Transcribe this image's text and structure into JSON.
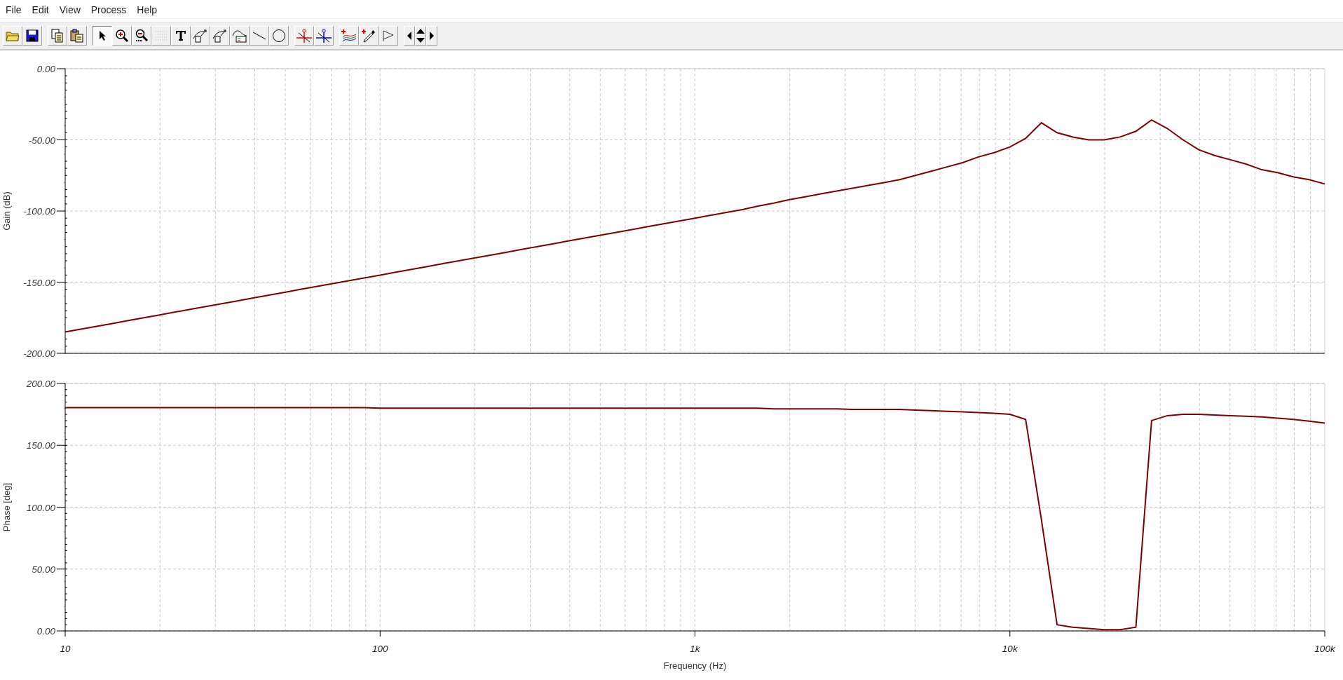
{
  "menu": [
    "File",
    "Edit",
    "View",
    "Process",
    "Help"
  ],
  "toolbar": [
    {
      "kind": "open",
      "selected": false
    },
    {
      "kind": "save",
      "selected": false
    },
    {
      "kind": "separator"
    },
    {
      "kind": "copy",
      "selected": false
    },
    {
      "kind": "paste",
      "selected": false
    },
    {
      "kind": "separator"
    },
    {
      "kind": "pointer",
      "selected": true
    },
    {
      "kind": "zoom-in",
      "selected": false
    },
    {
      "kind": "zoom-out",
      "selected": false
    },
    {
      "kind": "grid",
      "selected": false
    },
    {
      "kind": "text",
      "selected": false
    },
    {
      "kind": "label",
      "selected": false
    },
    {
      "kind": "label-query",
      "selected": false
    },
    {
      "kind": "legend",
      "selected": false
    },
    {
      "kind": "line",
      "selected": false
    },
    {
      "kind": "circle",
      "selected": false
    },
    {
      "kind": "separator"
    },
    {
      "kind": "cursor-a",
      "selected": false
    },
    {
      "kind": "cursor-b",
      "selected": false
    },
    {
      "kind": "separator"
    },
    {
      "kind": "add-curve",
      "selected": false
    },
    {
      "kind": "probe",
      "selected": false
    },
    {
      "kind": "marker",
      "selected": false
    },
    {
      "kind": "separator"
    },
    {
      "kind": "nav-left",
      "selected": false
    },
    {
      "kind": "nav-updown",
      "selected": false
    },
    {
      "kind": "nav-right",
      "selected": false
    }
  ],
  "plots": [
    {
      "chart_data": {
        "type": "line",
        "ylabel": "Gain (dB)",
        "grid": true,
        "ylim": [
          -200,
          0
        ],
        "yticks": [
          {
            "value": 0,
            "label": "0.00"
          },
          {
            "value": -50,
            "label": "-50.00"
          },
          {
            "value": -100,
            "label": "-100.00"
          },
          {
            "value": -150,
            "label": "-150.00"
          },
          {
            "value": -200,
            "label": "-200.00"
          }
        ],
        "series": [
          {
            "color": "#800000",
            "values": [
              -185,
              -183,
              -181,
              -179,
              -177,
              -175,
              -173,
              -171,
              -169,
              -167,
              -165,
              -163,
              -161,
              -159,
              -157,
              -155,
              -153,
              -151,
              -149,
              -147,
              -145,
              -143,
              -141,
              -139,
              -137,
              -135,
              -133,
              -131,
              -129,
              -127,
              -125,
              -123,
              -121,
              -119,
              -117,
              -115,
              -113,
              -111,
              -109,
              -107,
              -105,
              -103,
              -101,
              -99,
              -96.5,
              -94.5,
              -92,
              -90,
              -88,
              -86,
              -84,
              -82,
              -80,
              -78,
              -75,
              -72,
              -69,
              -66,
              -62,
              -59,
              -55,
              -49,
              -38,
              -45,
              -48,
              -50,
              -50,
              -48,
              -44,
              -36,
              -42,
              -50,
              -57,
              -61,
              -64,
              -67,
              -71,
              -73,
              -76,
              -78,
              -81
            ]
          }
        ]
      }
    },
    {
      "chart_data": {
        "type": "line",
        "ylabel": "Phase [deg]",
        "xlabel": "Frequency (Hz)",
        "grid": true,
        "ylim": [
          0,
          200
        ],
        "categories": [
          "10",
          null,
          null,
          null,
          null,
          null,
          null,
          null,
          null,
          null,
          null,
          null,
          null,
          null,
          null,
          null,
          null,
          null,
          null,
          null,
          "100",
          null,
          null,
          null,
          null,
          null,
          null,
          null,
          null,
          null,
          null,
          null,
          null,
          null,
          null,
          null,
          null,
          null,
          null,
          null,
          "1k",
          null,
          null,
          null,
          null,
          null,
          null,
          null,
          null,
          null,
          null,
          null,
          null,
          null,
          null,
          null,
          null,
          null,
          null,
          null,
          "10k",
          null,
          null,
          null,
          null,
          null,
          null,
          null,
          null,
          null,
          null,
          null,
          null,
          null,
          null,
          null,
          null,
          null,
          null,
          null,
          "100k"
        ],
        "yticks": [
          {
            "value": 200,
            "label": "200.00"
          },
          {
            "value": 150,
            "label": "150.00"
          },
          {
            "value": 100,
            "label": "100.00"
          },
          {
            "value": 50,
            "label": "50.00"
          },
          {
            "value": 0,
            "label": "0.00"
          }
        ],
        "series": [
          {
            "color": "#800000",
            "values": [
              180.5,
              180.5,
              180.5,
              180.5,
              180.5,
              180.5,
              180.5,
              180.5,
              180.5,
              180.5,
              180.5,
              180.5,
              180.5,
              180.5,
              180.5,
              180.5,
              180.5,
              180.5,
              180.5,
              180.5,
              180,
              180,
              180,
              180,
              180,
              180,
              180,
              180,
              180,
              180,
              180,
              180,
              180,
              180,
              180,
              180,
              180,
              180,
              180,
              180,
              180,
              180,
              180,
              180,
              180,
              179.5,
              179.5,
              179.5,
              179.5,
              179.5,
              179,
              179,
              179,
              179,
              178.5,
              178,
              177.5,
              177,
              176.5,
              176,
              175,
              171,
              90,
              5,
              3,
              2,
              1,
              1,
              3,
              170,
              174,
              175,
              175,
              174.5,
              174,
              173.5,
              173,
              172,
              171,
              169.5,
              168
            ]
          }
        ]
      }
    }
  ]
}
